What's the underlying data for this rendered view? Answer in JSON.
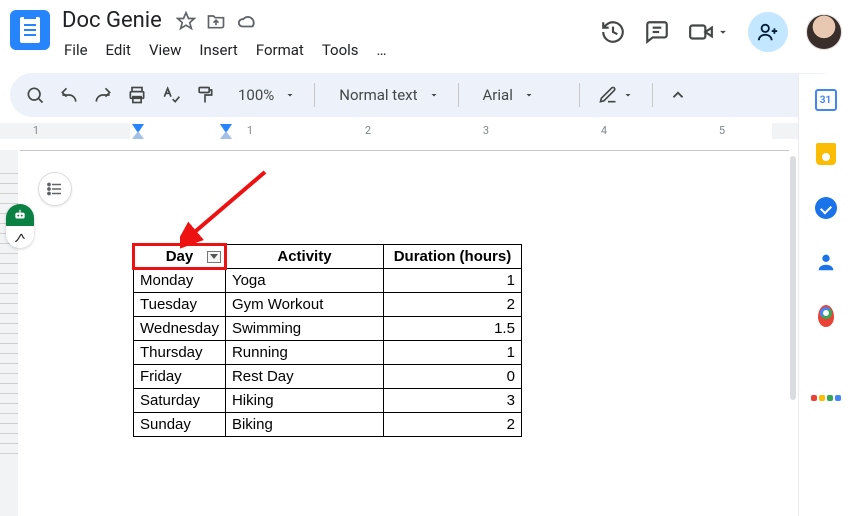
{
  "header": {
    "doc_title": "Doc Genie",
    "menus": [
      "File",
      "Edit",
      "View",
      "Insert",
      "Format",
      "Tools",
      "…"
    ]
  },
  "toolbar": {
    "zoom": "100%",
    "style": "Normal text",
    "font": "Arial"
  },
  "ruler": {
    "numbers": [
      "1",
      "1",
      "2",
      "3",
      "4",
      "5"
    ]
  },
  "table": {
    "headers": {
      "day": "Day",
      "activity": "Activity",
      "duration": "Duration (hours)"
    },
    "rows": [
      {
        "day": "Monday",
        "activity": "Yoga",
        "duration": "1"
      },
      {
        "day": "Tuesday",
        "activity": "Gym Workout",
        "duration": "2"
      },
      {
        "day": "Wednesday",
        "activity": "Swimming",
        "duration": "1.5"
      },
      {
        "day": "Thursday",
        "activity": "Running",
        "duration": "1"
      },
      {
        "day": "Friday",
        "activity": "Rest Day",
        "duration": "0"
      },
      {
        "day": "Saturday",
        "activity": "Hiking",
        "duration": "3"
      },
      {
        "day": "Sunday",
        "activity": "Biking",
        "duration": "2"
      }
    ]
  },
  "annotation": {
    "highlight_header": "Day"
  },
  "colors": {
    "accent": "#2684fc",
    "annotation": "#e11"
  }
}
